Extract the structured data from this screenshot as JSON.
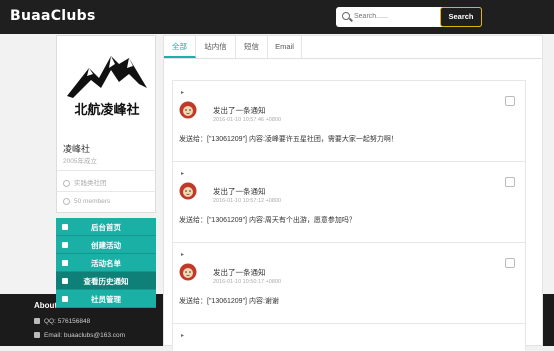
{
  "header": {
    "brand": "BuaaClubs",
    "search_placeholder": "Search......",
    "search_button": "Search"
  },
  "profile": {
    "logo_text": "北航凌峰社",
    "name": "凌峰社",
    "founded": "2005年成立",
    "type": "实践类社团",
    "members": "50 members"
  },
  "menu": {
    "items": [
      {
        "label": "后台首页",
        "icon": "gear-icon"
      },
      {
        "label": "创建活动",
        "icon": "gear-icon"
      },
      {
        "label": "活动名单",
        "icon": "list-icon"
      },
      {
        "label": "查看历史通知",
        "icon": "mail-icon"
      },
      {
        "label": "社员管理",
        "icon": "user-icon"
      }
    ],
    "active_index": 3
  },
  "tabs": [
    "全部",
    "站内信",
    "短信",
    "Email"
  ],
  "active_tab": 0,
  "notifications": [
    {
      "arrow": "▸",
      "title": "发出了一条通知",
      "time": "2016-01-10 10:57:46 +0800",
      "body": "发送给：[\"13061209\"] 内容:凌峰要许五星社团，需要大家一起努力啊！"
    },
    {
      "arrow": "▸",
      "title": "发出了一条通知",
      "time": "2016-01-10 10:57:12 +0800",
      "body": "发送给：[\"13061209\"] 内容:周天有个出游，愿意参加吗？"
    },
    {
      "arrow": "▸",
      "title": "发出了一条通知",
      "time": "2016-01-10 10:50:17 +0800",
      "body": "发送给：[\"13061209\"] 内容:谢谢"
    },
    {
      "arrow": "▸",
      "title": "",
      "time": "",
      "body": ""
    }
  ],
  "footer": {
    "title": "About",
    "qq": "QQ: 576156848",
    "email": "Email: buaaclubs@163.com"
  },
  "colors": {
    "topbar": "#1f1f1f",
    "accent": "#1ab0a6",
    "search_border": "#e0b400"
  }
}
